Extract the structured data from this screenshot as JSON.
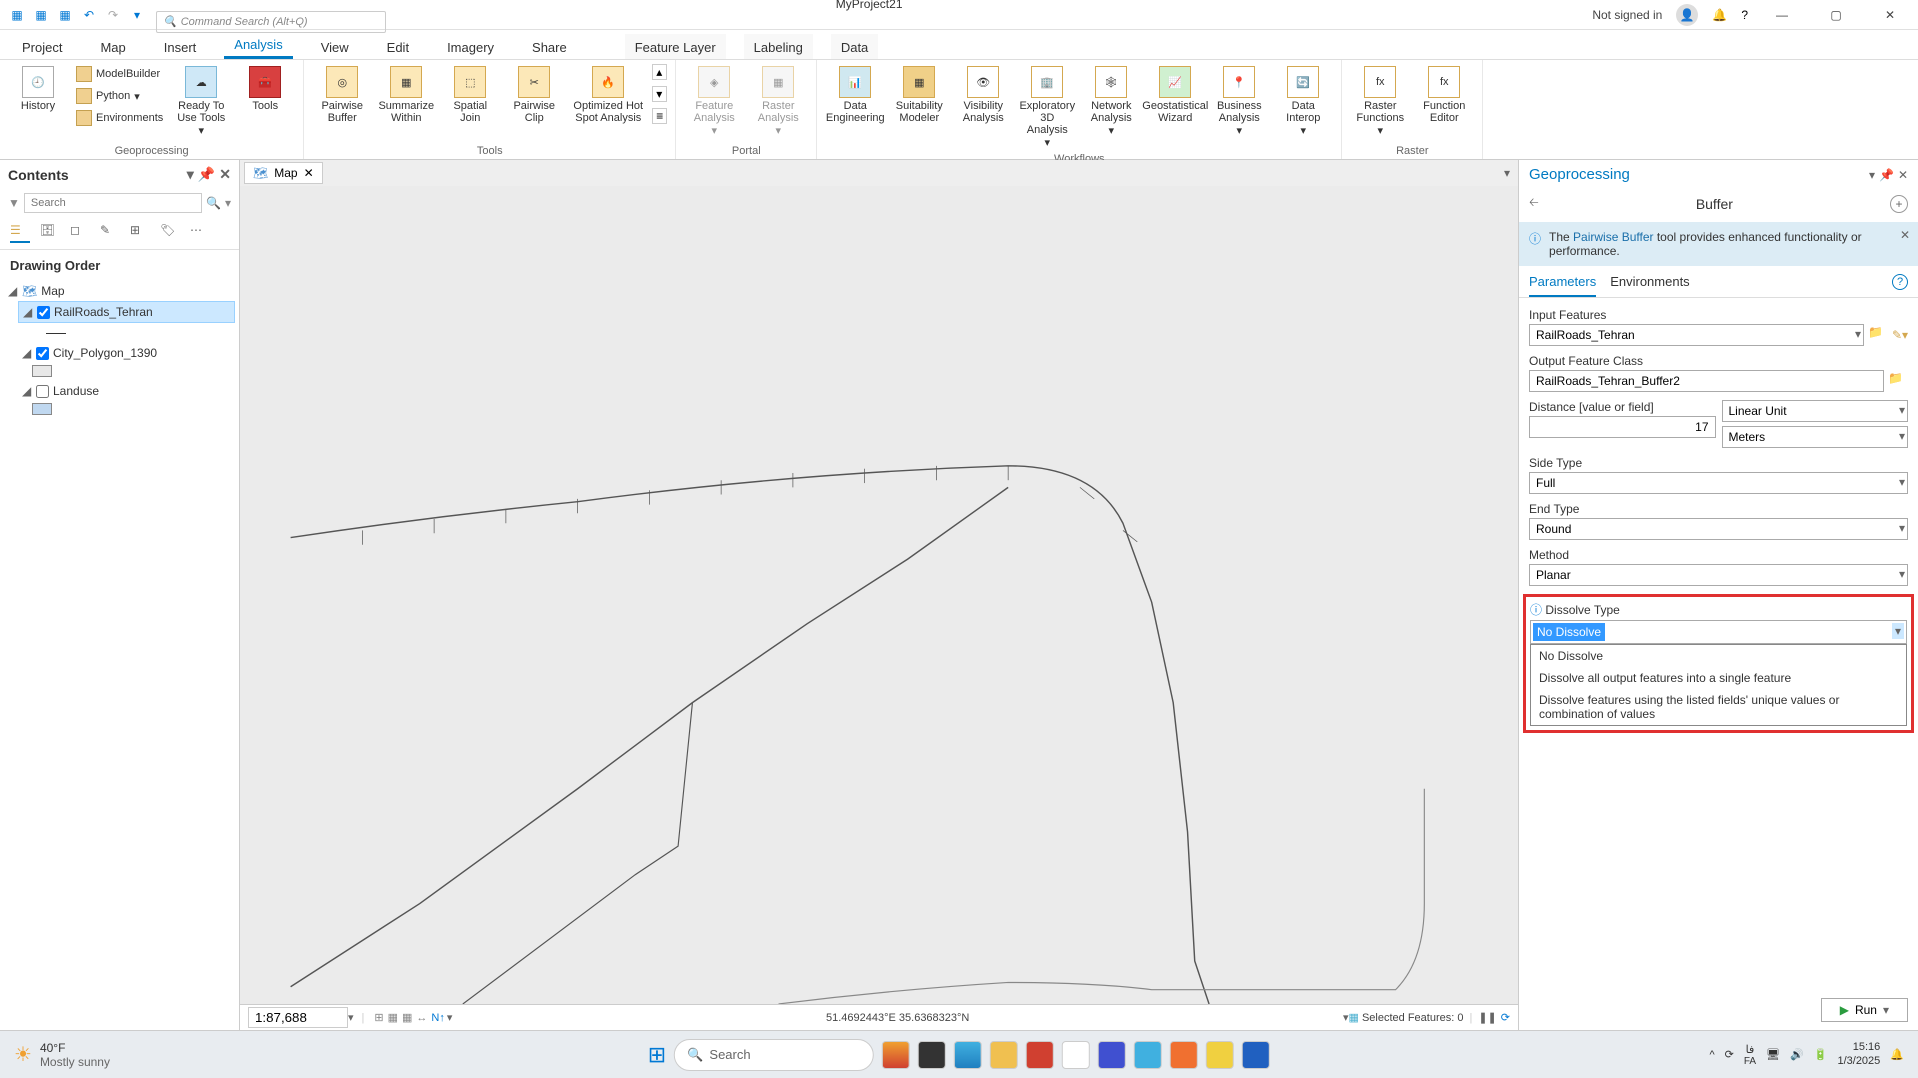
{
  "titlebar": {
    "project_name": "MyProject21",
    "search_placeholder": "Command Search (Alt+Q)",
    "signin": "Not signed in"
  },
  "ribbon": {
    "tabs": [
      "Project",
      "Map",
      "Insert",
      "Analysis",
      "View",
      "Edit",
      "Imagery",
      "Share"
    ],
    "active_tab": "Analysis",
    "context_tabs": [
      "Feature Layer",
      "Labeling",
      "Data"
    ],
    "groups": {
      "geoprocessing": {
        "label": "Geoprocessing",
        "history": "History",
        "modelbuilder": "ModelBuilder",
        "python": "Python",
        "environments": "Environments",
        "ready_to_use": "Ready To Use Tools",
        "tools": "Tools"
      },
      "tools": {
        "label": "Tools",
        "pairwise_buffer": "Pairwise Buffer",
        "summarize_within": "Summarize Within",
        "spatial_join": "Spatial Join",
        "pairwise_clip": "Pairwise Clip",
        "hotspot": "Optimized Hot Spot Analysis"
      },
      "portal": {
        "label": "Portal",
        "feature_analysis": "Feature Analysis",
        "raster_analysis": "Raster Analysis"
      },
      "workflows": {
        "label": "Workflows",
        "data_engineering": "Data Engineering",
        "suitability": "Suitability Modeler",
        "visibility": "Visibility Analysis",
        "exploratory": "Exploratory 3D Analysis",
        "network": "Network Analysis",
        "geostat": "Geostatistical Wizard",
        "business": "Business Analysis",
        "interop": "Data Interop"
      },
      "raster": {
        "label": "Raster",
        "functions": "Raster Functions",
        "editor": "Function Editor"
      }
    }
  },
  "contents": {
    "title": "Contents",
    "search_placeholder": "Search",
    "section": "Drawing Order",
    "map_name": "Map",
    "layers": [
      {
        "name": "RailRoads_Tehran",
        "checked": true,
        "selected": true,
        "symbol": "line"
      },
      {
        "name": "City_Polygon_1390",
        "checked": true,
        "selected": false,
        "symbol": "#e8e8e8"
      },
      {
        "name": "Landuse",
        "checked": false,
        "selected": false,
        "symbol": "#c0d8f0"
      }
    ]
  },
  "map": {
    "tab_name": "Map",
    "scale": "1:87,688",
    "coords": "51.4692443°E 35.6368323°N",
    "selected_features": "Selected Features: 0"
  },
  "gp": {
    "title": "Geoprocessing",
    "tool_name": "Buffer",
    "info_prefix": "The ",
    "info_link": "Pairwise Buffer",
    "info_suffix": " tool provides enhanced functionality or performance.",
    "tabs": [
      "Parameters",
      "Environments"
    ],
    "params": {
      "input_features": {
        "label": "Input Features",
        "value": "RailRoads_Tehran"
      },
      "output_fc": {
        "label": "Output Feature Class",
        "value": "RailRoads_Tehran_Buffer2"
      },
      "distance": {
        "label": "Distance [value or field]",
        "value": "17",
        "unit_type": "Linear Unit",
        "unit": "Meters"
      },
      "side_type": {
        "label": "Side Type",
        "value": "Full"
      },
      "end_type": {
        "label": "End Type",
        "value": "Round"
      },
      "method": {
        "label": "Method",
        "value": "Planar"
      },
      "dissolve_type": {
        "label": "Dissolve Type",
        "value": "No Dissolve",
        "options": [
          "No Dissolve",
          "Dissolve all output features into a single feature",
          "Dissolve features using the listed fields' unique values or combination of values"
        ]
      }
    },
    "run": "Run"
  },
  "taskbar": {
    "temp": "40°F",
    "condition": "Mostly sunny",
    "search": "Search",
    "lang": "FA",
    "lang_sub": "فا",
    "time": "15:16",
    "date": "1/3/2025"
  }
}
